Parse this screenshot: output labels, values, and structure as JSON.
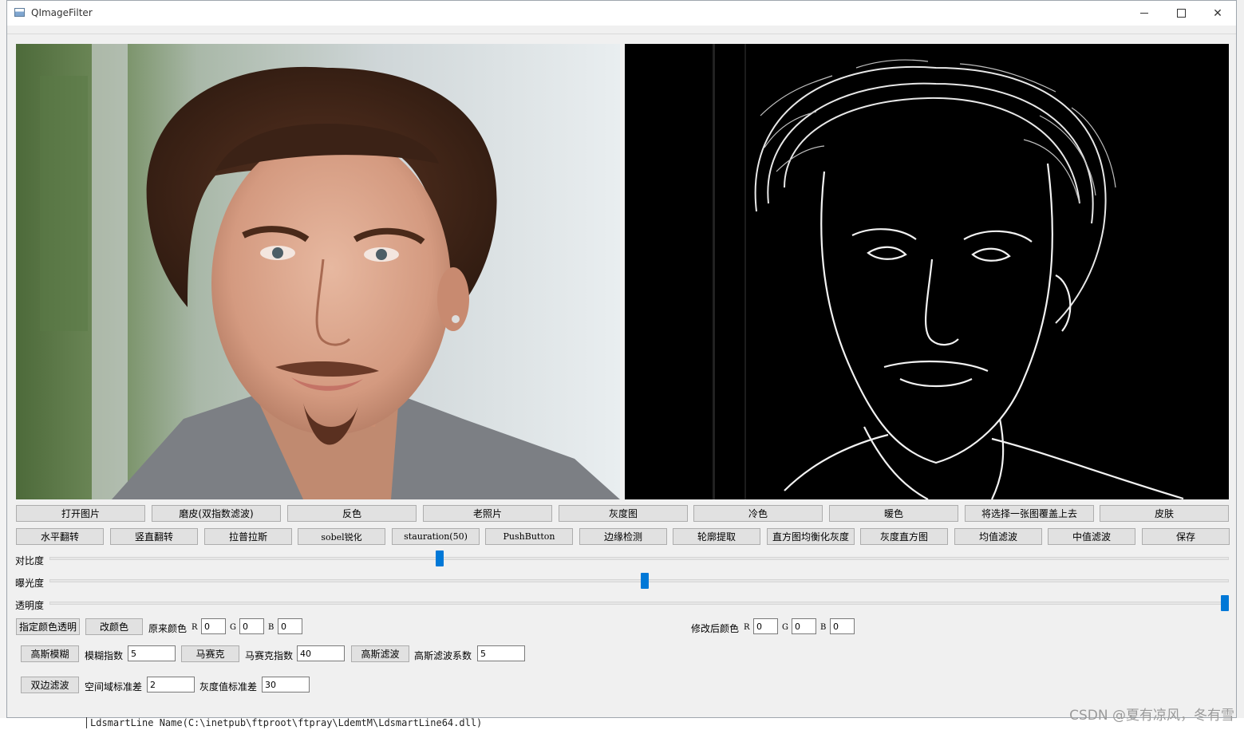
{
  "window": {
    "title": "QImageFilter"
  },
  "row1_buttons": [
    "打开图片",
    "磨皮(双指数滤波)",
    "反色",
    "老照片",
    "灰度图",
    "冷色",
    "暖色",
    "将选择一张图覆盖上去",
    "皮肤"
  ],
  "row2_buttons": [
    "水平翻转",
    "竖直翻转",
    "拉普拉斯",
    "sobel锐化",
    "stauration(50)",
    "PushButton",
    "边缘检测",
    "轮廓提取",
    "直方图均衡化灰度",
    "灰度直方图",
    "均值滤波",
    "中值滤波",
    "保存"
  ],
  "sliders": [
    {
      "label": "对比度",
      "value": 0.33
    },
    {
      "label": "曝光度",
      "value": 0.505
    },
    {
      "label": "透明度",
      "value": 1.0
    }
  ],
  "color_row": {
    "specify_transparent": "指定颜色透明",
    "change_color": "改颜色",
    "original_label": "原来颜色",
    "modified_label": "修改后颜色",
    "r": "R",
    "g": "G",
    "b": "B",
    "original": {
      "r": "0",
      "g": "0",
      "b": "0"
    },
    "modified": {
      "r": "0",
      "g": "0",
      "b": "0"
    }
  },
  "blur_row": {
    "gaussian_blur": "高斯模糊",
    "blur_index_label": "模糊指数",
    "blur_index": "5",
    "mosaic": "马赛克",
    "mosaic_index_label": "马赛克指数",
    "mosaic_index": "40",
    "gaussian_filter": "高斯滤波",
    "gaussian_coef_label": "高斯滤波系数",
    "gaussian_coef": "5"
  },
  "bilateral_row": {
    "bilateral": "双边滤波",
    "spatial_label": "空间域标准差",
    "spatial": "2",
    "gray_label": "灰度值标准差",
    "gray": "30"
  },
  "background_text": "LdsmartLine Name(C:\\inetpub\\ftproot\\ftpray\\LdemtM\\LdsmartLine64.dll)",
  "watermark": "CSDN @夏有凉风，冬有雪"
}
